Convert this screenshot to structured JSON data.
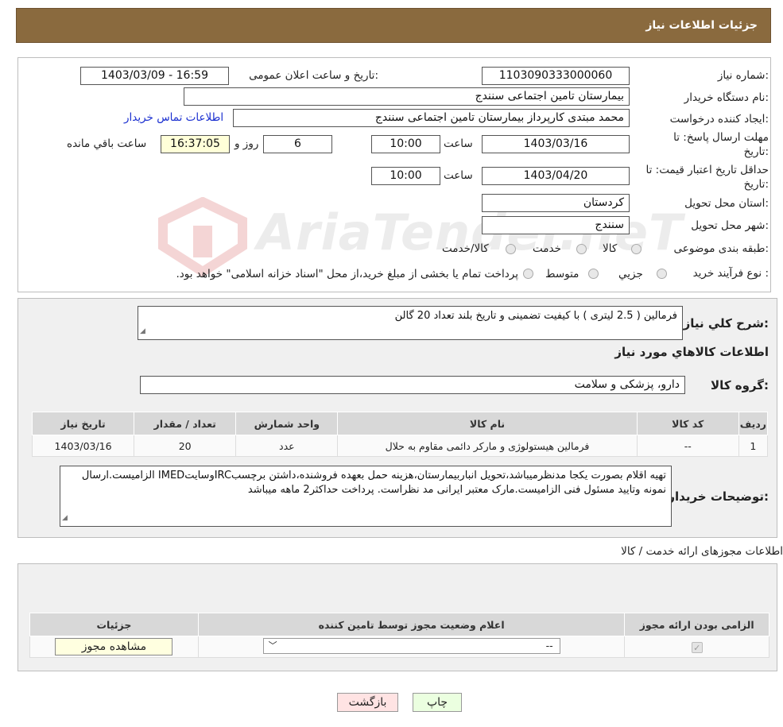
{
  "header": {
    "title": "جزئیات اطلاعات نیاز"
  },
  "watermark": {
    "text": "AriaTender.neT"
  },
  "form": {
    "need_number_label": "شماره نیاز:",
    "need_number": "1103090333000060",
    "announce_label": "تاریخ و ساعت اعلان عمومی:",
    "announce_value": "1403/03/09 - 16:59",
    "buyer_org_label": "نام دستگاه خریدار:",
    "buyer_org": "بیمارستان تامین اجتماعی سنندج",
    "creator_label": "ایجاد کننده درخواست:",
    "creator": "محمد مبتدی کارپرداز بیمارستان تامین اجتماعی سنندج",
    "contact_link": "اطلاعات تماس خریدار",
    "deadline_label_1": "مهلت ارسال پاسخ: تا",
    "deadline_label_2": "تاریخ:",
    "deadline_date": "1403/03/16",
    "time_label": "ساعت",
    "deadline_time": "10:00",
    "days_value": "6",
    "days_label": "روز و",
    "remaining_time": "16:37:05",
    "remaining_label": "ساعت باقي مانده",
    "validity_label_1": "حداقل تاریخ اعتبار قیمت: تا",
    "validity_label_2": "تاریخ:",
    "validity_date": "1403/04/20",
    "validity_time": "10:00",
    "province_label": "استان محل تحویل:",
    "province": "کردستان",
    "city_label": "شهر محل تحویل:",
    "city": "سنندج",
    "category_label": "طبقه بندی موضوعی:",
    "category_options": [
      "کالا",
      "خدمت",
      "کالا/خدمت"
    ],
    "process_label": "نوع فرآیند خرید :",
    "process_options": [
      "جزیي",
      "متوسط"
    ],
    "process_note": "پرداخت تمام یا بخشی از مبلغ خرید،از محل \"اسناد خزانه اسلامی\" خواهد بود."
  },
  "summary": {
    "desc_label": "شرح کلي نیاز:",
    "desc": "فرمالین ( 2.5 لیتری ) با کیفیت تضمینی و تاریخ بلند تعداد 20 گالن",
    "goods_info_title": "اطلاعات کالاهاي مورد نیاز",
    "group_label": "گروه کالا:",
    "group": "دارو، پزشکی و سلامت",
    "table": {
      "headers": [
        "ردیف",
        "کد کالا",
        "نام کالا",
        "واحد شمارش",
        "تعداد / مقدار",
        "تاریخ نیاز"
      ],
      "rows": [
        [
          "1",
          "--",
          "فرمالین هیستولوژی و مارکر دائمی مقاوم به حلال",
          "عدد",
          "20",
          "1403/03/16"
        ]
      ]
    },
    "buyer_notes_label": "توضیحات خریدار:",
    "buyer_notes": "تهیه اقلام بصورت یکجا مدنظرمیباشد،تحویل انباربیمارستان،هزینه حمل بعهده فروشنده،داشتن برچسبIRCوسایتIMED الزامیست.ارسال نمونه وتایید مسئول فنی الزامیست.مارک معتبر ایرانی مد نظراست. پرداخت حداکثر2 ماهه میباشد"
  },
  "permits": {
    "title": "اطلاعات مجوزهای ارائه خدمت / کالا",
    "headers": [
      "الزامی بودن ارائه مجوز",
      "اعلام وضعیت مجوز توسط تامین کننده",
      "جزئیات"
    ],
    "select_value": "--",
    "view_button": "مشاهده مجوز"
  },
  "buttons": {
    "print": "چاپ",
    "back": "بازگشت"
  }
}
